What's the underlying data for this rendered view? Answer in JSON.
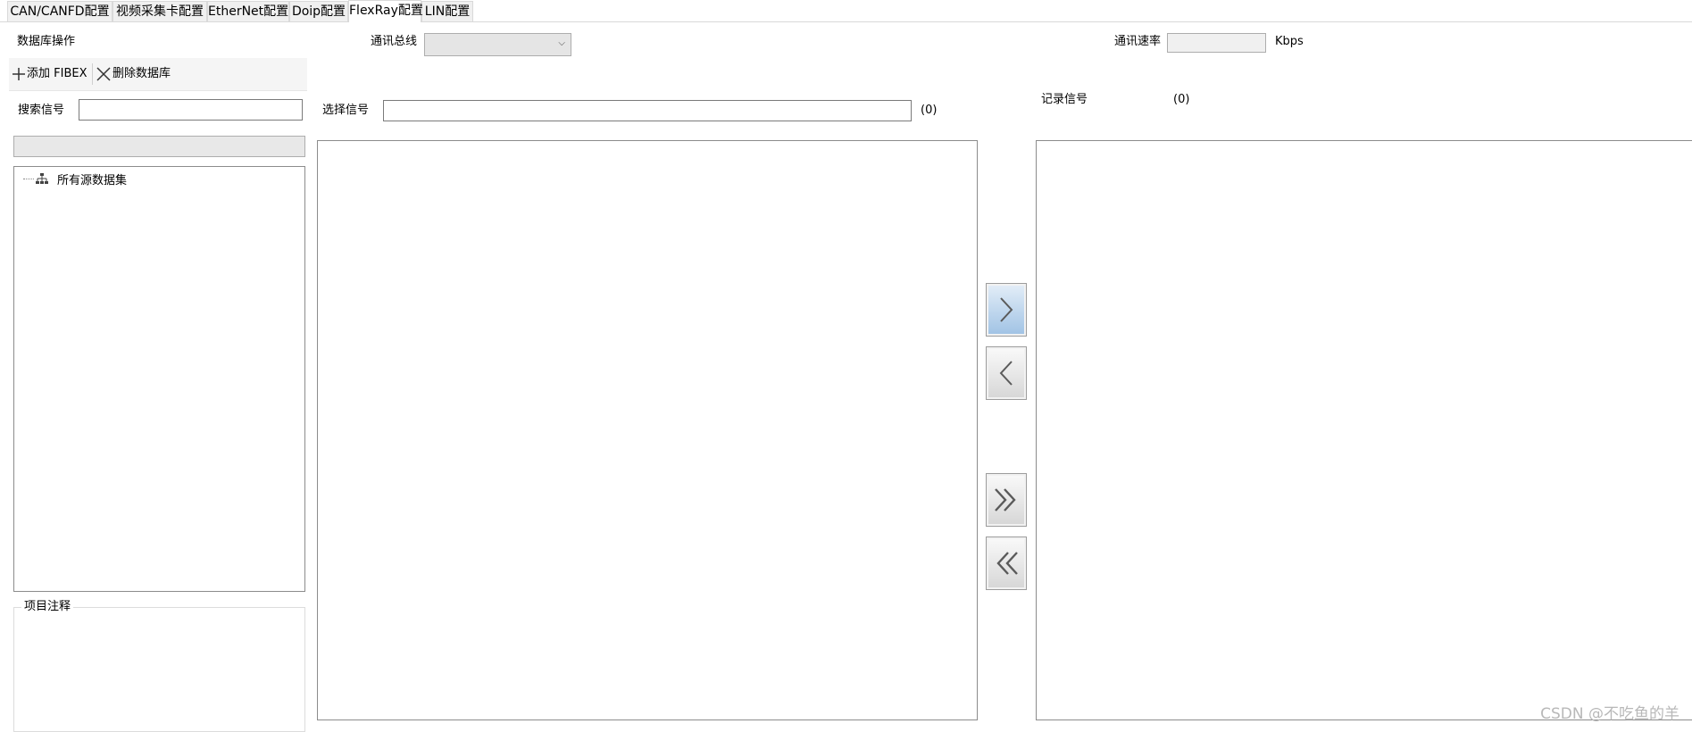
{
  "tabs": [
    {
      "label": "CAN/CANFD配置",
      "active": false
    },
    {
      "label": "视频采集卡配置",
      "active": false
    },
    {
      "label": "EtherNet配置",
      "active": false
    },
    {
      "label": "Doip配置",
      "active": false
    },
    {
      "label": "FlexRay配置",
      "active": true
    },
    {
      "label": "LIN配置",
      "active": false
    }
  ],
  "database": {
    "section_label": "数据库操作",
    "add_label": "添加 FIBEX",
    "delete_label": "删除数据库"
  },
  "bus": {
    "label": "通讯总线",
    "selected": ""
  },
  "rate": {
    "label": "通讯速率",
    "value": "",
    "unit": "Kbps"
  },
  "search": {
    "label": "搜索信号",
    "value": ""
  },
  "tree": {
    "root_label": "所有源数据集"
  },
  "notes": {
    "title": "项目注释"
  },
  "select": {
    "label": "选择信号",
    "value": "",
    "count": "(0)"
  },
  "record": {
    "label": "记录信号",
    "count": "(0)"
  },
  "watermark": "CSDN @不吃鱼的羊",
  "colors": {
    "active_tab_bg": "#ffffff",
    "inactive_tab_bg": "#f0f0f0",
    "primary_button": "#9fc2e4",
    "border": "#8c8c8c"
  }
}
